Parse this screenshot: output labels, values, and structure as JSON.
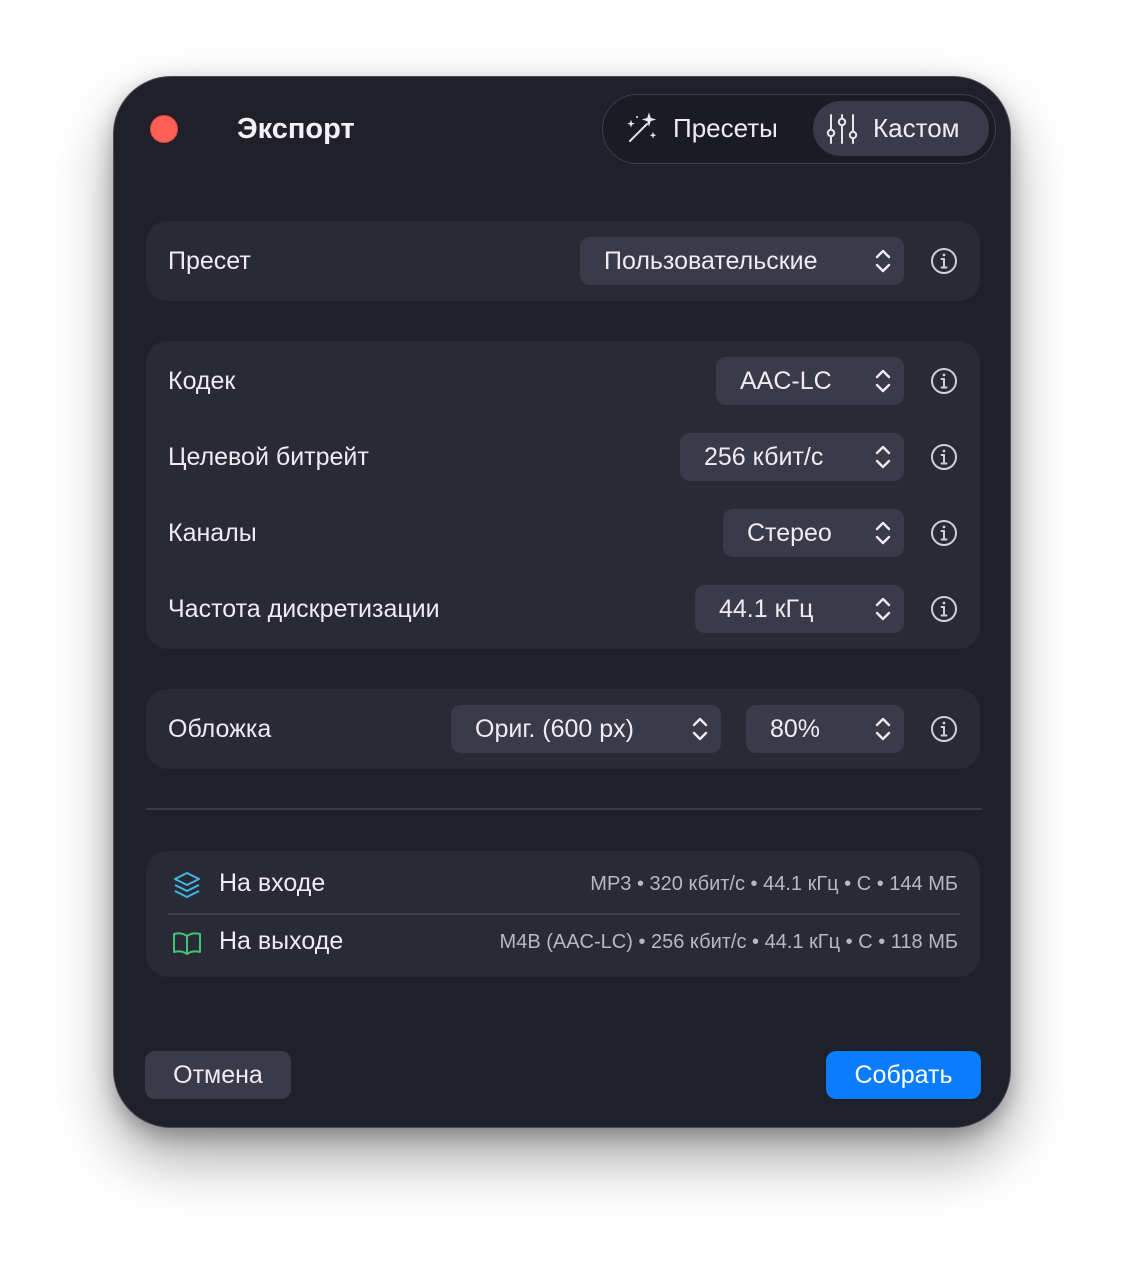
{
  "window": {
    "title": "Экспорт",
    "mode_presets_label": "Пресеты",
    "mode_custom_label": "Кастом",
    "selected_mode": "custom"
  },
  "preset": {
    "label": "Пресет",
    "value": "Пользовательские"
  },
  "settings": [
    {
      "label": "Кодек",
      "value": "AAC-LC"
    },
    {
      "label": "Целевой битрейт",
      "value": "256 кбит/с"
    },
    {
      "label": "Каналы",
      "value": "Стерео"
    },
    {
      "label": "Частота дискретизации",
      "value": "44.1 кГц"
    }
  ],
  "cover": {
    "label": "Обложка",
    "size_value": "Ориг. (600 px)",
    "quality_value": "80%"
  },
  "io": {
    "input_label": "На входе",
    "input_meta": "MP3 • 320 кбит/с • 44.1 кГц • С • 144 МБ",
    "output_label": "На выходе",
    "output_meta": "M4B (AAC-LC) • 256 кбит/с • 44.1 кГц • С • 118 МБ"
  },
  "buttons": {
    "cancel": "Отмена",
    "build": "Собрать"
  },
  "colors": {
    "accent": "#0a7cff",
    "close": "#ff5f57",
    "input_icon": "#3fb8e0",
    "output_icon": "#3ec57a"
  },
  "icons": {
    "presets": "magic-wand-icon",
    "custom": "sliders-icon",
    "input": "layers-icon",
    "output": "book-icon",
    "info": "info-circle-icon",
    "stepper": "chevron-up-down-icon"
  }
}
